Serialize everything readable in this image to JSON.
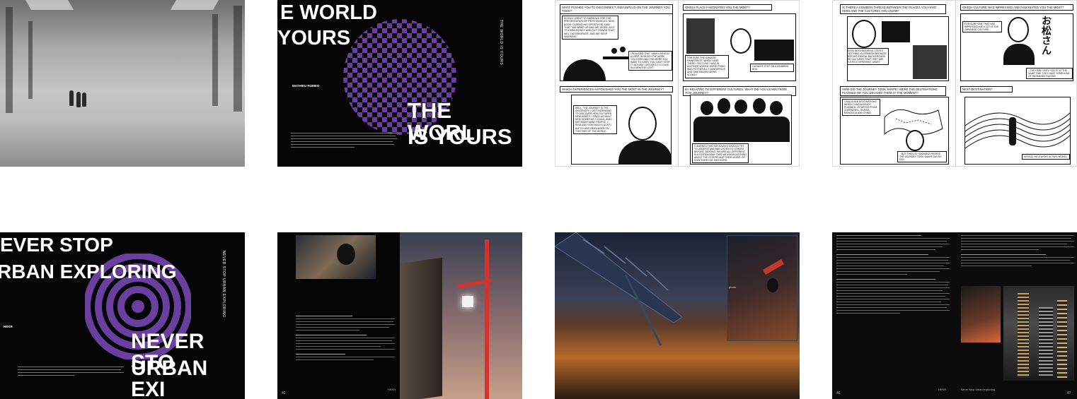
{
  "spread2": {
    "title_top_line1": "E WORLD",
    "title_top_line2": "YOURS",
    "title_bottom_line1": "THE WORL",
    "title_bottom_line2": "IS YOURS",
    "author": "MATHIEU ROMEO",
    "vertical_title": "THE WORLD IS YOURS",
    "pattern_color": "#6b3fa0"
  },
  "spread3": {
    "q1": "WHAT PUSHED YOU TO DISCONNECT AND UNPLUG ON THE JOURNEY YOU TOOK?",
    "q2": "WHICH PLACE FASCINATED YOU THE MOST?",
    "q3": "WHICH EXPERIENCES ASTONISHED YOU THE MOST IN THE JOURNEY?",
    "q4": "BY RELATING TO DIFFERENT CULTURES, WHAT DID YOU LEARN FROM THIS JOURNEY?",
    "cap_a": "IN 2016 I WENT TO MAREALE FOR THE PRESENTATION OF PEPE MUJICA'S NEW BOOK. DURING HIS SPEECH HE SAID THAT \"WE WAKE UP AND WE WORK JUST TO EARN MONEY AND BUY THINGS THAT WILL DETERIORATE, AND WE KEEP WORKING\".",
    "cap_b": "I REALIZED THAT I WAS LIVING IN A LOOP, IN WHICH THE MORE YOU EARN AND THE MORE YOU WANT TO EARN. YOU CAN'T STOP IT. IN A WAY I DECIDED TO LEAVE, IN A MONTHS I LEFT.",
    "cap_c": "FOR SURE THE AMAZON RAINFOREST. WHEN I WAS THERE I FELT LIKE I WAS IN ANOTHER WORLD. EVERYTHING WAS POTENTIALLY DANGEROUS AND TIME PASSED MORE SLOWLY.",
    "cap_d": "I ALMOST STEP ON A RAINBOW BOA",
    "cap_e": "WELL, THE JOURNEY IS THE DISCOVERY. I LEFT INTENDING TO DISCOVER NEW CULTURES, NEW HABITS. I TRIED AS MANY NEW DISHES AS I COULD, AND I MET MANY MANY PEOPLE. I REALIZED HOW MUCH LUCKY I AM TO HAVE BEEN BORN ON THIS SIDE OF THE WORLD.",
    "cap_f": "I LEARNED THAT WE ALWAYS SHOULD TRY TO UNDERSTAND AND LISTEN TO OTHERS BEFORE JUDGING. WE ARE ALL DIFFERENT, IN A CERTAIN WAY THAT WE KNOW NOTHING ABOUT THE OTHERS AND THEIR MODEL OF HOW THEIR DAY WAS BORN."
  },
  "spread4": {
    "q1": "IS THERE A COMMON THREAD BETWEEN THE PLACES YOU HAVE SEEN AND THE CULTURES YOU KNOW?",
    "q2": "WHICH CULTURE WAS IMPRESSED AND FASCINATED YOU THE MOST?",
    "q3": "HOW DID THE JOURNEY TOOK SHAPE? WERE THE DESTINATIONS PLANNED OR YOU DECIDED THEM AT THE MOMENT?",
    "q4": "NEXT DESTINATION?",
    "cap_a": "YES, EVEN NEIGHBOURING STATES HAVE NOTHING IN COMMON BECAUSE OF THEIR HISTORICAL BACKGROUND. ALL THE CULTURES THAT I MET ARE COMPLETELY DIFFERENT, APART.",
    "cap_b": "FOR SURE ONE THAT HAS IMPRESSED ME A LOT IS THE JAPANESE CULTURE...",
    "cap_c": "...THEY ARE VERY POLITE AT THE SAME TIME THEY HAVE SOME KIND OF INGRAINED RACISM.",
    "cap_d": "I HAD SOME DESTINATIONS WHICH I HAD ALREADY PLANNED, I STARTED FROM CHERNOBYL, RUSSIA, MONGOLIA AND CHINA.",
    "cap_e": "...BUT THEN, BY KNOWING PEOPLE, THE JOURNEY TOOK SHAPE DAY BY DAY.",
    "cap_f": "AFRICA, I'M LEAVING IN TWO WEEKS.",
    "jp_text": "お松さん"
  },
  "spread5": {
    "title_line1": "EVER STOP",
    "title_line2": "RBAN EXPLORING",
    "title_bottom_line1": "NEVER STO",
    "title_bottom_line2": "URBAN EXI",
    "author": "HEKR",
    "vertical_title": "NEVER STOP URBAN EXPLORING"
  },
  "spread6": {
    "page_number": "42",
    "footer": "HEKR",
    "crane_color": "#d8312a"
  },
  "spread7": {
    "photo_label": "photo"
  },
  "spread8": {
    "page_left": "46",
    "page_right": "47",
    "footer_left": "HEKR",
    "footer_right": "Never stop urban exploring"
  }
}
